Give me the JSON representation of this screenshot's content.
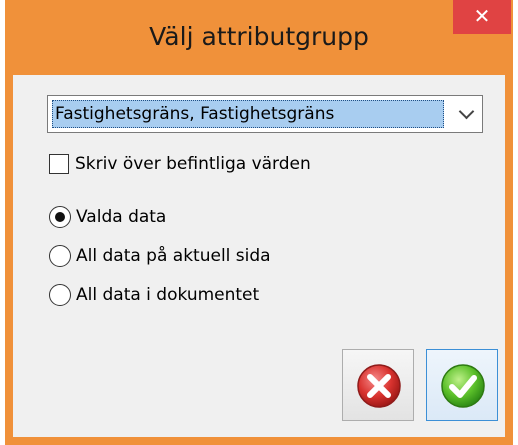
{
  "window": {
    "title": "Välj attributgrupp",
    "close_icon": "close-icon",
    "accent_color": "#f0913a",
    "close_color": "#e04343"
  },
  "attribute_group": {
    "selected_value": "Fastighetsgräns, Fastighetsgräns",
    "chevron_icon": "chevron-down-icon"
  },
  "overwrite": {
    "label": "Skriv över befintliga värden",
    "checked": false
  },
  "scope": {
    "options": [
      {
        "label": "Valda data",
        "checked": true
      },
      {
        "label": "All data på aktuell sida",
        "checked": false
      },
      {
        "label": "All data i dokumentet",
        "checked": false
      }
    ]
  },
  "buttons": {
    "cancel_icon": "cancel-icon",
    "ok_icon": "ok-check-icon"
  }
}
